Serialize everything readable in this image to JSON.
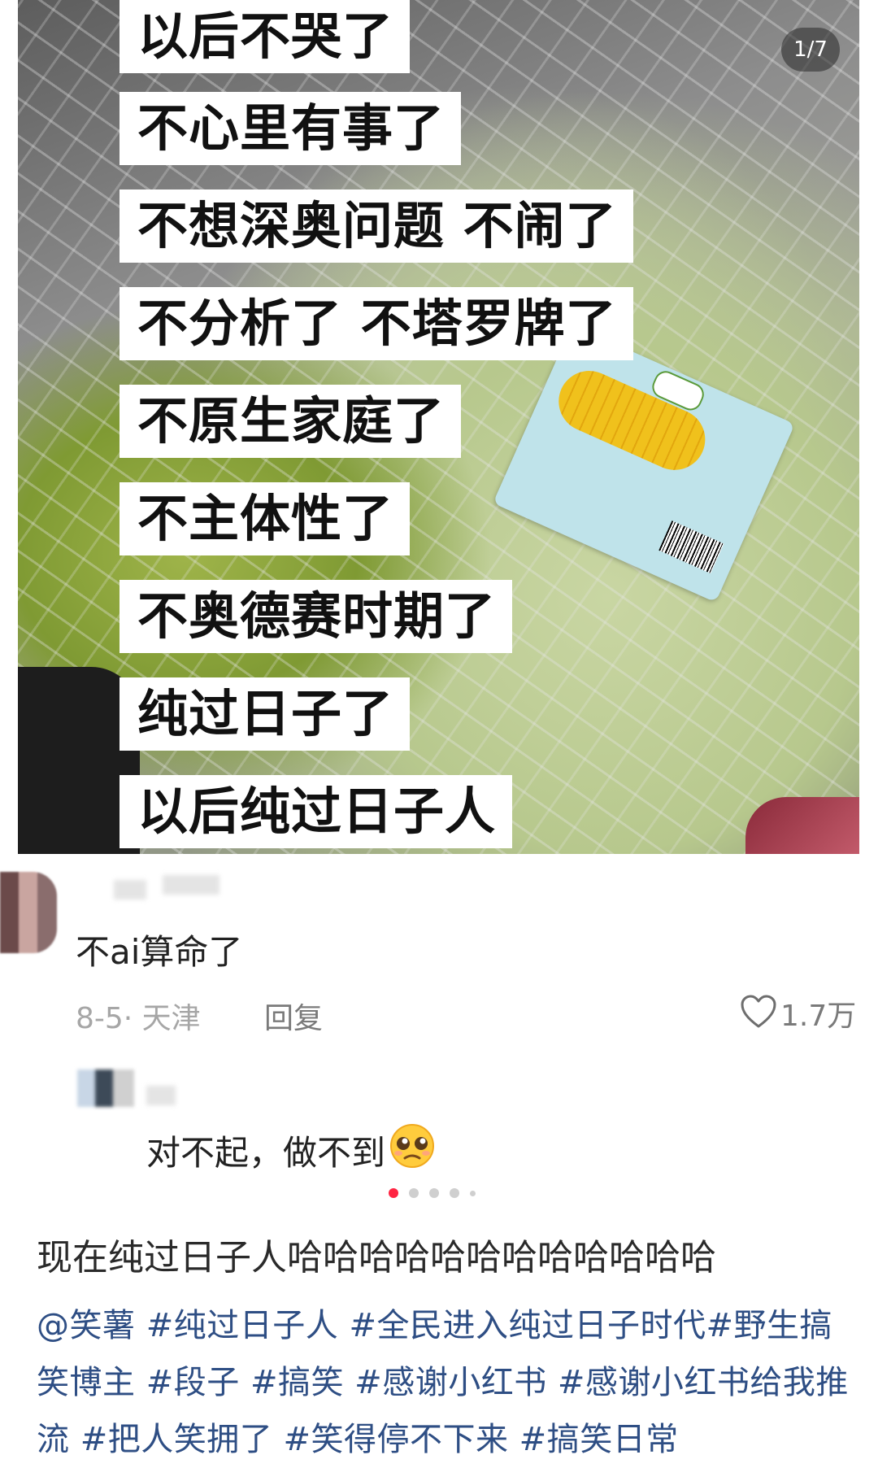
{
  "hero": {
    "counter": "1/7",
    "overlay_lines": [
      "以后不哭了",
      "不心里有事了",
      "不想深奥问题 不闹了",
      "不分析了 不塔罗牌了",
      "不原生家庭了",
      "不主体性了",
      "不奥德赛时期了",
      "纯过日子了",
      "以后纯过日子人"
    ]
  },
  "comments": [
    {
      "text": "不ai算命了",
      "date_location": "8-5· 天津",
      "reply_label": "回复",
      "likes": "1.7万"
    },
    {
      "text": "对不起，做不到"
    }
  ],
  "carousel": {
    "total": 5,
    "active_index": 0
  },
  "post": {
    "title": "现在纯过日子人哈哈哈哈哈哈哈哈哈哈哈哈",
    "tags_text": "@笑薯 #纯过日子人 #全民进入纯过日子时代#野生搞笑博主 #段子 #搞笑 #感谢小红书 #感谢小红书给我推流 #把人笑拥了 #笑得停不下来 #搞笑日常"
  },
  "colors": {
    "accent": "#ff2442",
    "tag_blue": "#2e4e84",
    "meta_gray": "#a6a6a6"
  },
  "icons": [
    "heart-outline-icon",
    "pleading-face-emoji-icon"
  ]
}
